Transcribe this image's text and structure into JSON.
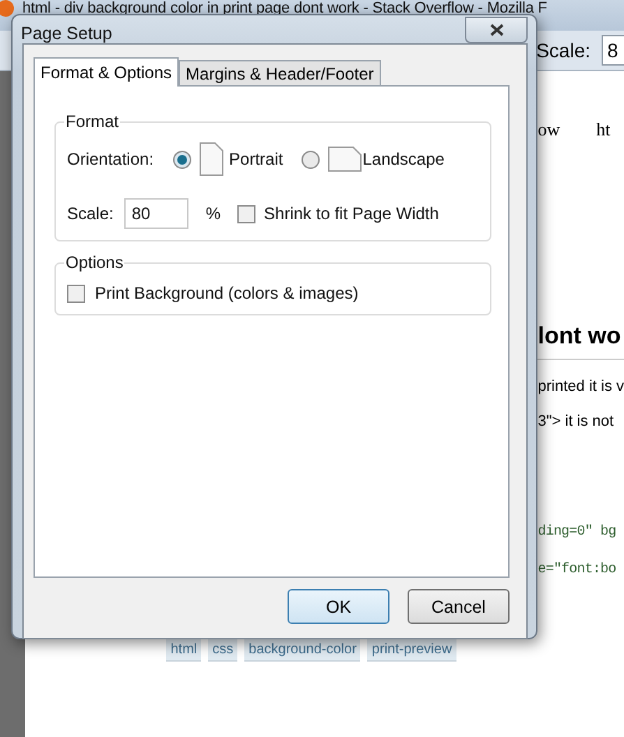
{
  "browser": {
    "title": "html - div background color in print page dont work - Stack Overflow - Mozilla F",
    "toolbar": {
      "scale_label": "Scale:",
      "scale_value": "8"
    },
    "content": [
      {
        "kind": "nav",
        "texts": [
          "ow",
          "ht"
        ]
      },
      {
        "kind": "heading",
        "texts": [
          "lont wo"
        ]
      },
      {
        "kind": "text",
        "texts": [
          "printed it is v"
        ]
      },
      {
        "kind": "text",
        "texts": [
          "3\">  it is not"
        ]
      },
      {
        "kind": "code",
        "texts": [
          "ding=0\" bg"
        ]
      },
      {
        "kind": "code",
        "texts": [
          "e=\"font:bo"
        ]
      }
    ],
    "tags": [
      "html",
      "css",
      "background-color",
      "print-preview"
    ]
  },
  "dialog": {
    "title": "Page Setup",
    "tabs": [
      {
        "label": "Format & Options",
        "selected": true
      },
      {
        "label": "Margins & Header/Footer",
        "selected": false
      }
    ],
    "format": {
      "legend": "Format",
      "orientation_label": "Orientation:",
      "orientations": [
        {
          "kind": "portrait",
          "label": "Portrait",
          "selected": true
        },
        {
          "kind": "landscape",
          "label": "Landscape",
          "selected": false
        }
      ],
      "scale_label": "Scale:",
      "scale_value": "80",
      "unit": "%",
      "shrink": {
        "label": "Shrink to fit Page Width",
        "checked": false
      }
    },
    "options": {
      "legend": "Options",
      "checkboxes": [
        {
          "label": "Print Background (colors & images)",
          "checked": false
        }
      ]
    },
    "buttons": [
      {
        "label": "OK",
        "default": true
      },
      {
        "label": "Cancel",
        "default": false
      }
    ]
  }
}
